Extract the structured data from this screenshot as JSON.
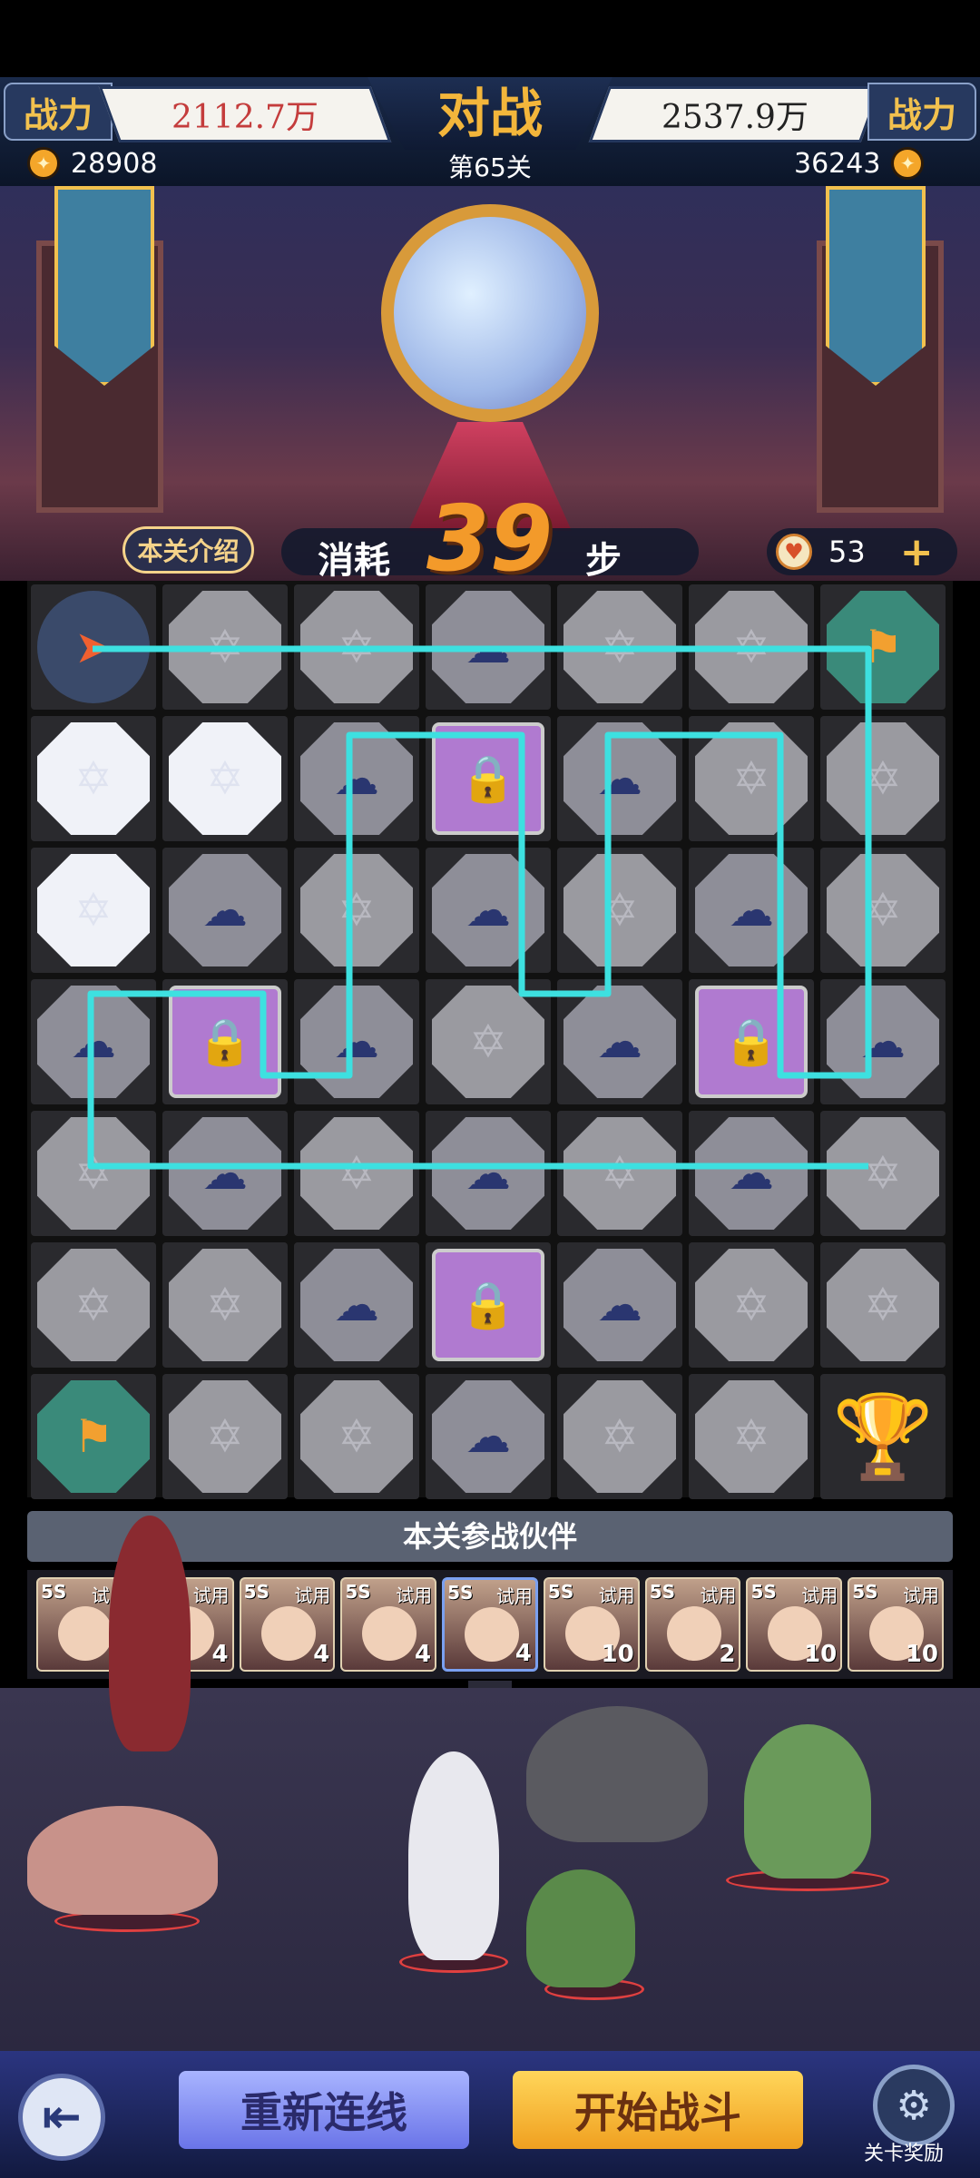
{
  "header": {
    "power_label_left": "战力",
    "power_left": "2112.7万",
    "title": "对战",
    "power_right": "2537.9万",
    "power_label_right": "战力",
    "coins_left": "28908",
    "stage": "第65关",
    "coins_right": "36243"
  },
  "steps": {
    "intro_label": "本关介绍",
    "prefix": "消耗",
    "count": "39",
    "suffix": "步",
    "energy": "53",
    "plus": "+"
  },
  "board": {
    "rows": 7,
    "cols": 7,
    "tiles": [
      [
        "rocket",
        "grey",
        "grey",
        "cloud",
        "grey",
        "grey",
        "post"
      ],
      [
        "white",
        "white",
        "cloud",
        "lock",
        "cloud",
        "grey",
        "grey"
      ],
      [
        "white",
        "cloud",
        "grey",
        "cloud",
        "grey",
        "cloud",
        "grey"
      ],
      [
        "cloud",
        "lock",
        "cloud",
        "grey",
        "cloud",
        "lock",
        "cloud"
      ],
      [
        "grey",
        "cloud",
        "grey",
        "cloud",
        "grey",
        "cloud",
        "grey"
      ],
      [
        "grey",
        "grey",
        "cloud",
        "lock",
        "cloud",
        "grey",
        "grey"
      ],
      [
        "post",
        "grey",
        "grey",
        "cloud",
        "grey",
        "grey",
        "trophy"
      ]
    ]
  },
  "partners": {
    "title": "本关参战伙伴",
    "items": [
      {
        "grade": "5S",
        "trial": "试用",
        "level": "4"
      },
      {
        "grade": "5S",
        "trial": "试用",
        "level": "4"
      },
      {
        "grade": "5S",
        "trial": "试用",
        "level": "4"
      },
      {
        "grade": "5S",
        "trial": "试用",
        "level": "4"
      },
      {
        "grade": "5S",
        "trial": "试用",
        "level": "4"
      },
      {
        "grade": "5S",
        "trial": "试用",
        "level": "10"
      },
      {
        "grade": "5S",
        "trial": "试用",
        "level": "2"
      },
      {
        "grade": "5S",
        "trial": "试用",
        "level": "10"
      },
      {
        "grade": "5S",
        "trial": "试用",
        "level": "10"
      }
    ]
  },
  "bottom": {
    "back_icon": "back-arrow-icon",
    "relink_label": "重新连线",
    "start_label": "开始战斗",
    "reward_label": "关卡奖励"
  },
  "colors": {
    "path": "#3de0e0",
    "accent_gold": "#f3b63b",
    "power_left_red": "#c43c3c"
  }
}
